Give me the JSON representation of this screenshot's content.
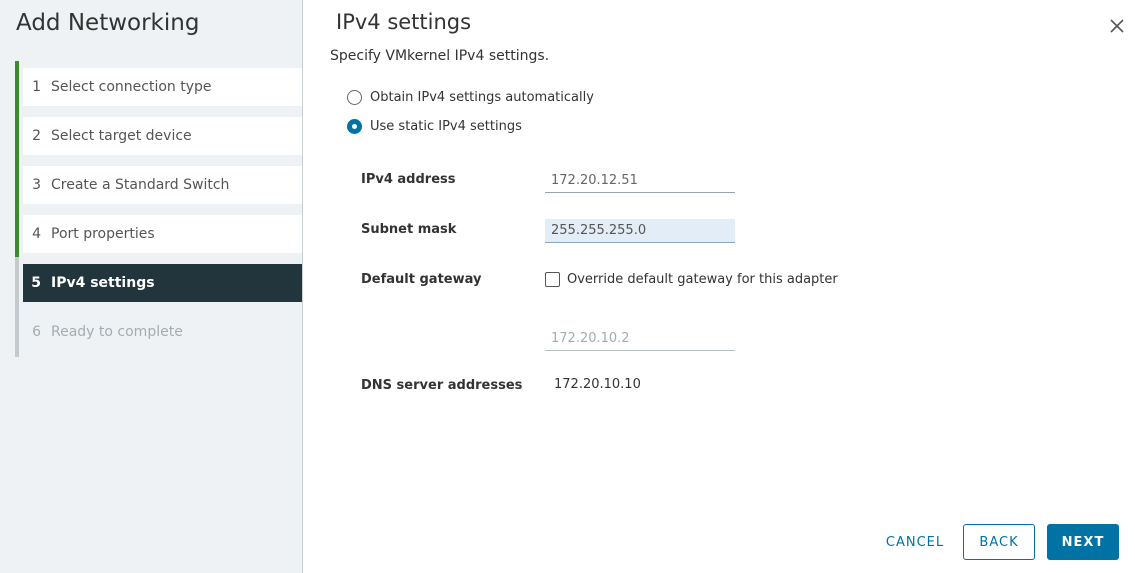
{
  "sidebar": {
    "title": "Add Networking",
    "steps": [
      {
        "num": "1",
        "label": "Select connection type"
      },
      {
        "num": "2",
        "label": "Select target device"
      },
      {
        "num": "3",
        "label": "Create a Standard Switch"
      },
      {
        "num": "4",
        "label": "Port properties"
      },
      {
        "num": "5",
        "label": "IPv4 settings"
      },
      {
        "num": "6",
        "label": "Ready to complete"
      }
    ]
  },
  "main": {
    "title": "IPv4 settings",
    "subtitle": "Specify VMkernel IPv4 settings.",
    "radio_auto": "Obtain IPv4 settings automatically",
    "radio_static": "Use static IPv4 settings",
    "fields": {
      "ipv4_label": "IPv4 address",
      "ipv4_value": "172.20.12.51",
      "subnet_label": "Subnet mask",
      "subnet_value": "255.255.255.0",
      "gateway_label": "Default gateway",
      "gateway_override": "Override default gateway for this adapter",
      "gateway_value": "172.20.10.2",
      "dns_label": "DNS server addresses",
      "dns_value": "172.20.10.10"
    }
  },
  "footer": {
    "cancel": "CANCEL",
    "back": "BACK",
    "next": "NEXT"
  },
  "colors": {
    "accent": "#0072a3",
    "completed_bar": "#3c8a2e",
    "active_step_bg": "#22343c",
    "sidebar_bg": "#eef2f4"
  }
}
